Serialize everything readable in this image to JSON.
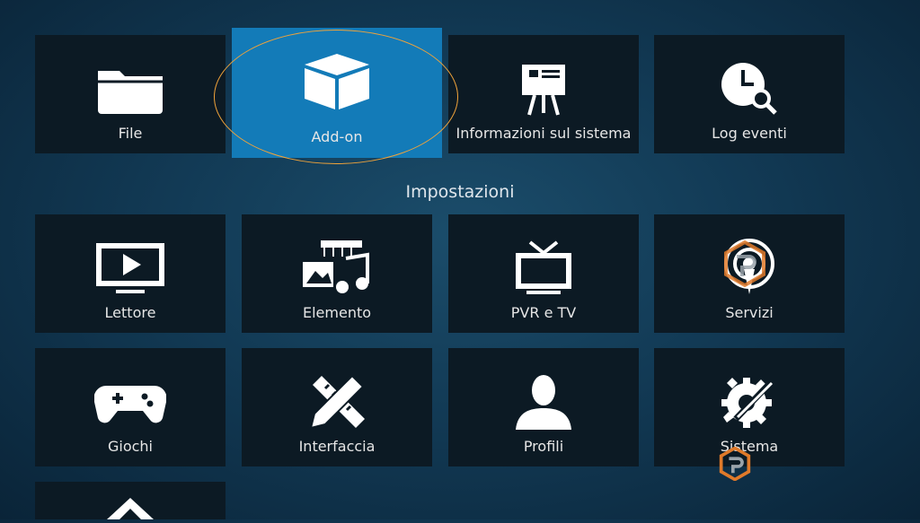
{
  "top_row": [
    {
      "id": "file",
      "label": "File",
      "icon": "folder-icon"
    },
    {
      "id": "addon",
      "label": "Add-on",
      "icon": "box-icon",
      "focused": true
    },
    {
      "id": "sysinfo",
      "label": "Informazioni sul sistema",
      "icon": "presentation-board-icon"
    },
    {
      "id": "log",
      "label": "Log eventi",
      "icon": "clock-search-icon"
    }
  ],
  "section_title": "Impostazioni",
  "settings": [
    {
      "id": "player",
      "label": "Lettore",
      "icon": "tv-play-icon"
    },
    {
      "id": "media",
      "label": "Elemento",
      "icon": "media-library-icon"
    },
    {
      "id": "pvr",
      "label": "PVR e TV",
      "icon": "antenna-tv-icon"
    },
    {
      "id": "services",
      "label": "Servizi",
      "icon": "broadcast-icon"
    },
    {
      "id": "games",
      "label": "Giochi",
      "icon": "gamepad-icon"
    },
    {
      "id": "interface",
      "label": "Interfaccia",
      "icon": "pencil-ruler-icon"
    },
    {
      "id": "profiles",
      "label": "Profili",
      "icon": "user-profile-icon"
    },
    {
      "id": "system",
      "label": "Sistema",
      "icon": "gear-wrench-icon"
    }
  ],
  "partial_row": [
    {
      "id": "skin",
      "icon": "kodi-logo-icon"
    }
  ],
  "colors": {
    "focus": "#137bb8",
    "tile": "#0c1a24",
    "ring": "#f0a33a"
  }
}
